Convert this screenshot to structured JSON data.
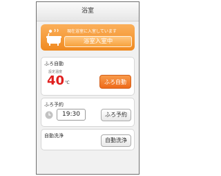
{
  "header": {
    "title": "浴室"
  },
  "banner": {
    "message": "現在浴室に入室しています",
    "status": "浴室入室中"
  },
  "auto_bath": {
    "title": "ふろ自動",
    "setting_label": "設定温度",
    "temperature": "40",
    "unit": "℃",
    "button_label": "ふろ自動"
  },
  "bath_reservation": {
    "title": "ふろ予約",
    "time": "19:30",
    "button_label": "ふろ予約"
  },
  "auto_wash": {
    "title": "自動洗浄",
    "button_label": "自動洗浄"
  },
  "colors": {
    "accent_orange": "#f08a20",
    "temperature_red": "#e0201f"
  }
}
